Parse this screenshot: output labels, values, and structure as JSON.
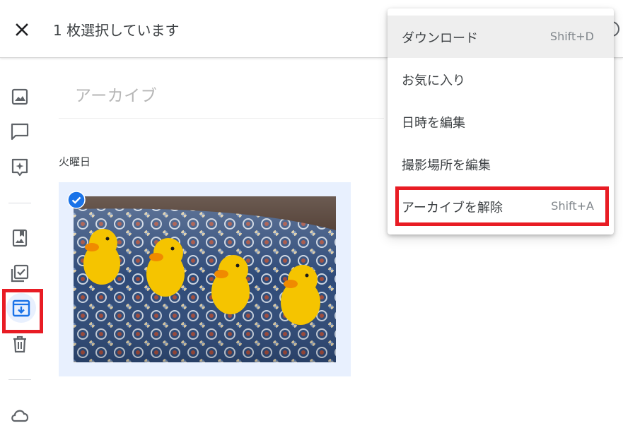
{
  "header": {
    "close_icon": "close-icon",
    "selection_text": "1 枚選択しています"
  },
  "album": {
    "title_placeholder": "アーカイブ",
    "date_group": "火曜日"
  },
  "rail": {
    "icons": [
      "photo-icon",
      "comment-icon",
      "add-to-album-icon",
      "book-icon",
      "checklist-icon",
      "archive-icon",
      "trash-icon",
      "cloud-icon"
    ]
  },
  "menu": {
    "items": [
      {
        "label": "ダウンロード",
        "shortcut": "Shift+D"
      },
      {
        "label": "お気に入り",
        "shortcut": ""
      },
      {
        "label": "日時を編集",
        "shortcut": ""
      },
      {
        "label": "撮影場所を編集",
        "shortcut": ""
      },
      {
        "label": "アーカイブを解除",
        "shortcut": "Shift+A"
      }
    ]
  },
  "colors": {
    "accent_blue": "#1a73e8",
    "highlight_red": "#e81c24",
    "selected_bg": "#e8f0fe"
  }
}
